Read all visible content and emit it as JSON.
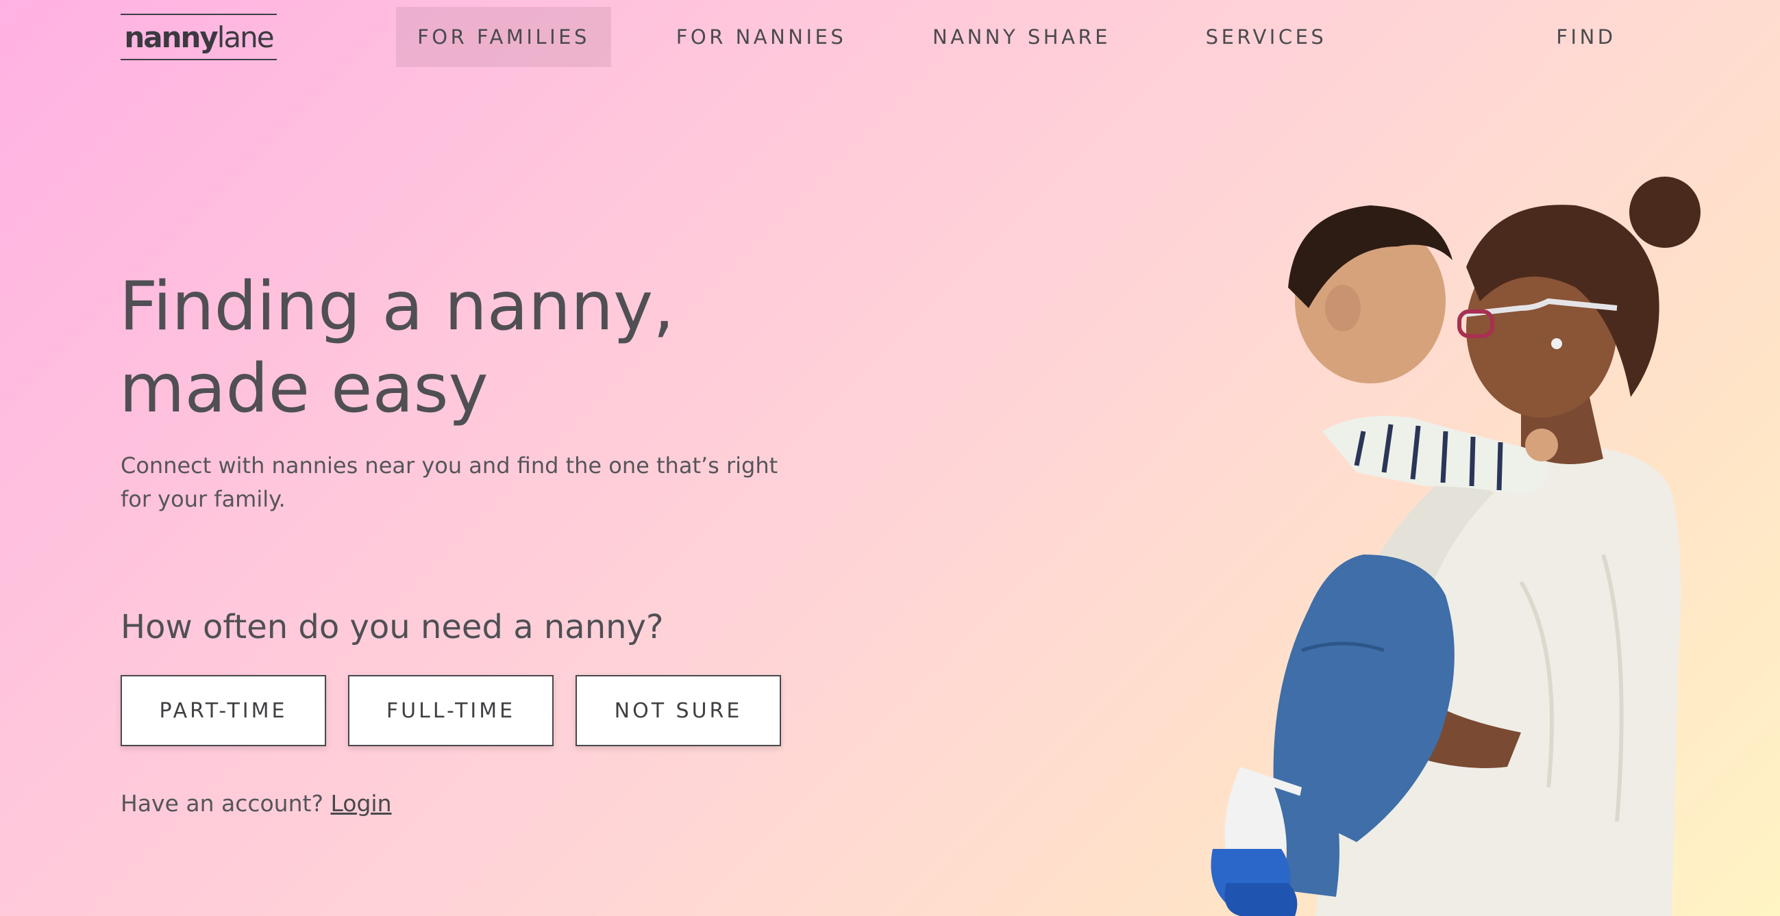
{
  "nav": {
    "logo_bold": "nanny",
    "logo_light": "lane",
    "items": [
      {
        "label": "FOR FAMILIES",
        "active": true
      },
      {
        "label": "FOR NANNIES",
        "active": false
      },
      {
        "label": "NANNY SHARE",
        "active": false
      },
      {
        "label": "SERVICES",
        "active": false
      },
      {
        "label": "FIND",
        "active": false
      }
    ]
  },
  "hero": {
    "title_line1": "Finding a nanny,",
    "title_line2": "made easy",
    "subtitle": "Connect with nannies near you and find the one that’s right for your family.",
    "question": "How often do you need a nanny?",
    "options": [
      "PART-TIME",
      "FULL-TIME",
      "NOT SURE"
    ],
    "account_prompt": "Have an account?",
    "login_label": "Login",
    "image": "mother-holding-toddler-photo"
  },
  "colors": {
    "gradient_start": "#ffb1e3",
    "gradient_mid": "#ffd6d6",
    "gradient_end": "#fff4c4",
    "text": "#4a4a4e",
    "active_nav_bg": "#e0b4c8",
    "button_bg": "#ffffff"
  }
}
